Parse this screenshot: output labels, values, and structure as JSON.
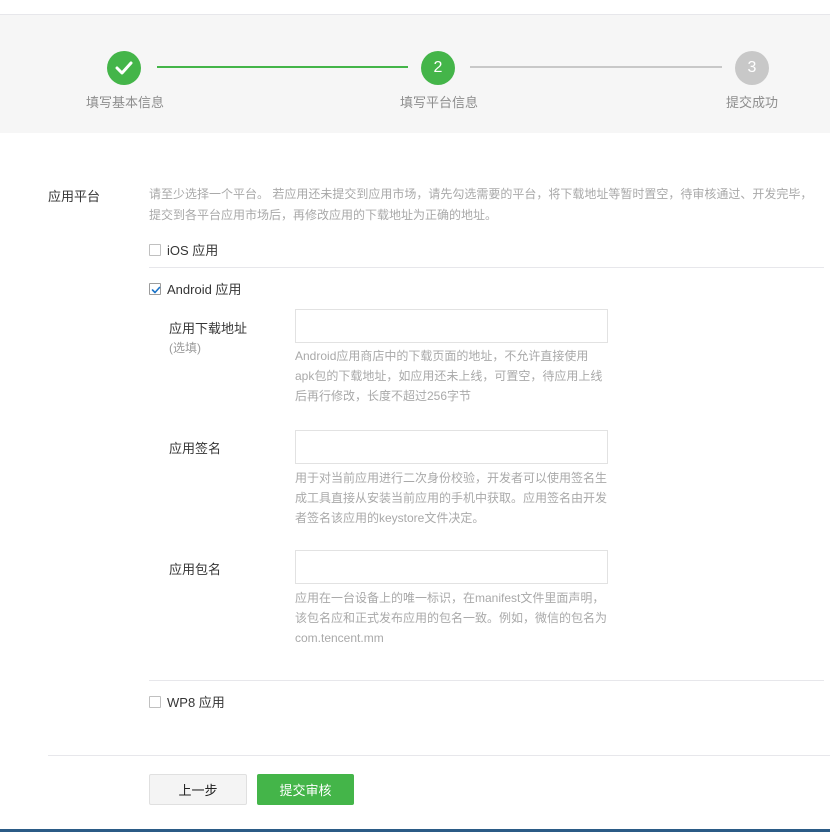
{
  "steps": [
    {
      "label": "填写基本信息",
      "state": "done"
    },
    {
      "label": "填写平台信息",
      "number": "2",
      "state": "active"
    },
    {
      "label": "提交成功",
      "number": "3",
      "state": "todo"
    }
  ],
  "platform": {
    "label": "应用平台",
    "hint": "请至少选择一个平台。 若应用还未提交到应用市场，请先勾选需要的平台，将下载地址等暂时置空，待审核通过、开发完毕，提交到各平台应用市场后，再修改应用的下载地址为正确的地址。",
    "ios": {
      "label": "iOS 应用",
      "checked": false
    },
    "android": {
      "label": "Android 应用",
      "checked": true
    },
    "wp8": {
      "label": "WP8 应用",
      "checked": false
    }
  },
  "android_fields": {
    "download": {
      "label": "应用下载地址",
      "sublabel": "(选填)",
      "value": "",
      "hint": "Android应用商店中的下载页面的地址，不允许直接使用apk包的下载地址，如应用还未上线，可置空，待应用上线后再行修改，长度不超过256字节"
    },
    "signature": {
      "label": "应用签名",
      "value": "",
      "hint": "用于对当前应用进行二次身份校验，开发者可以使用签名生成工具直接从安装当前应用的手机中获取。应用签名由开发者签名该应用的keystore文件决定。"
    },
    "package": {
      "label": "应用包名",
      "value": "",
      "hint": "应用在一台设备上的唯一标识，在manifest文件里面声明，该包名应和正式发布应用的包名一致。例如，微信的包名为com.tencent.mm"
    }
  },
  "buttons": {
    "prev": "上一步",
    "submit": "提交审核"
  },
  "colors": {
    "accent": "#44b549",
    "inactive": "#c8c8c8"
  }
}
